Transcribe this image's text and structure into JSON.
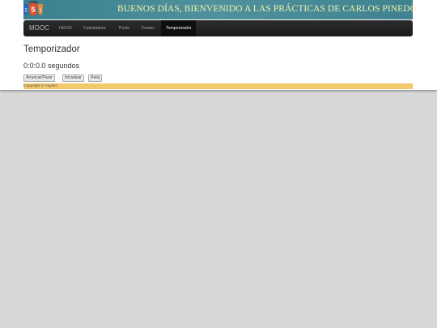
{
  "header": {
    "logo_label": "HTML",
    "logo_left_number": "3",
    "logo_right_number": "5",
    "title": "BUENOS DÍAS, BIENVENIDO A LAS PRÁCTICAS DE CARLOS PINEDO"
  },
  "navbar": {
    "brand": "MOOC",
    "items": [
      {
        "label": "INICIO"
      },
      {
        "label": "Calculadora"
      },
      {
        "label": "Puzle"
      },
      {
        "label": "Frases"
      },
      {
        "label": "Temporizador",
        "active": true
      }
    ]
  },
  "main": {
    "heading": "Temporizador",
    "timer_display": "0:0:0.0 segundos",
    "buttons": {
      "start_stop": "Arrancar/Parar",
      "reset": "Inicializar",
      "clock": "Reloj"
    }
  },
  "footer": {
    "copyright": "Copyright © Yuyset"
  },
  "colors": {
    "banner": "#4f929e",
    "banner_title": "#f3f0a8",
    "navbar": "#1b1b1b",
    "footer": "#f4c96c",
    "background": "#d8d8d8",
    "logo_left": "#2965b8",
    "logo_right": "#e8893a"
  }
}
